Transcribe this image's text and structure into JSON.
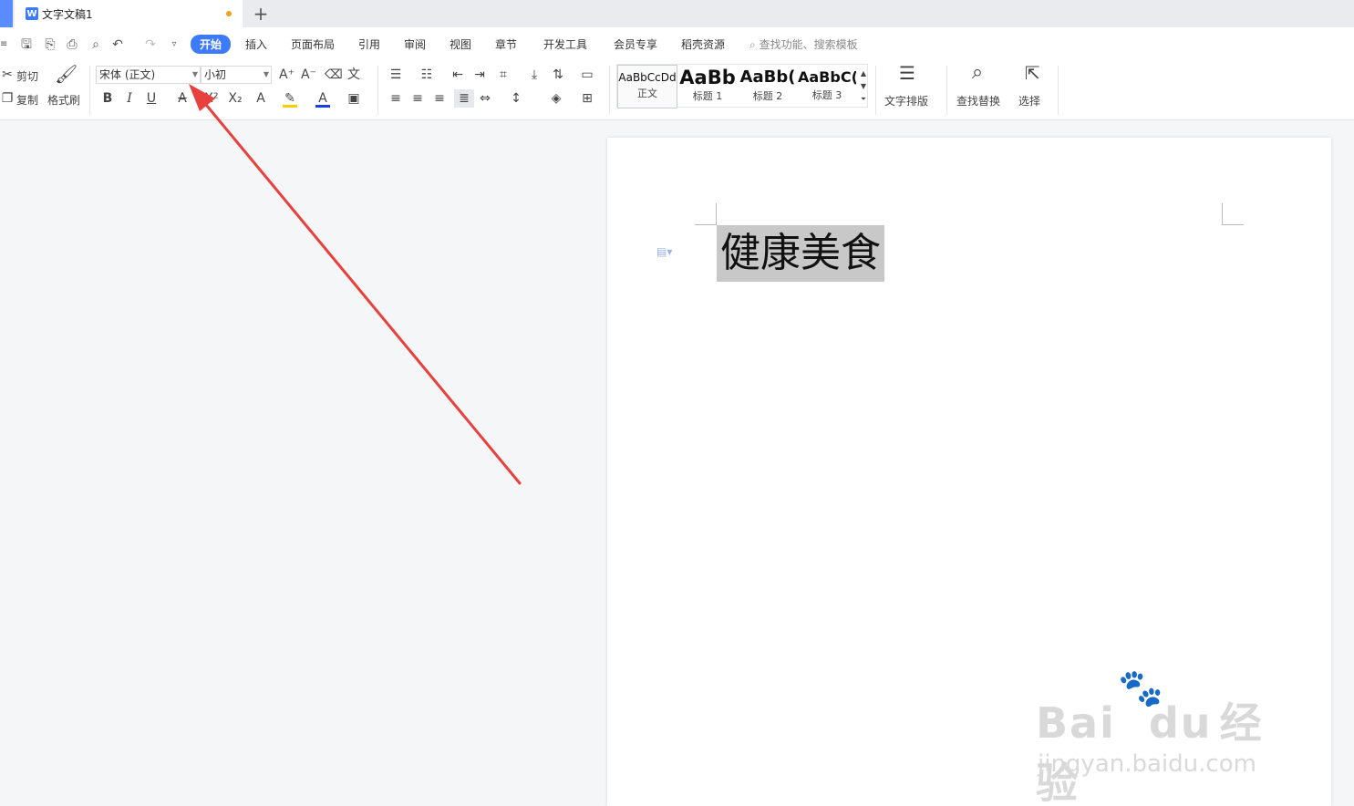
{
  "tab": {
    "title": "文字文稿1",
    "doc_icon": "W",
    "new_tab_icon": "+"
  },
  "menu": {
    "items": [
      "开始",
      "插入",
      "页面布局",
      "引用",
      "审阅",
      "视图",
      "章节",
      "开发工具",
      "会员专享",
      "稻壳资源"
    ],
    "search_placeholder": "查找功能、搜索模板"
  },
  "quick_access": [
    "save-icon",
    "export-pdf-icon",
    "print-icon",
    "print-preview-icon",
    "undo-icon",
    "redo-icon",
    "customize-icon"
  ],
  "clipboard": {
    "cut": "剪切",
    "copy": "复制",
    "format_painter": "格式刷"
  },
  "font": {
    "family": "宋体 (正文)",
    "size": "小初",
    "bold": "B",
    "italic": "I",
    "underline": "U",
    "strike": "A",
    "superscript": "X²",
    "subscript": "X₂"
  },
  "styles": [
    {
      "sample": "AaBbCcDd",
      "name": "正文"
    },
    {
      "sample": "AaBb",
      "name": "标题 1"
    },
    {
      "sample": "AaBb(",
      "name": "标题 2"
    },
    {
      "sample": "AaBbC(",
      "name": "标题 3"
    }
  ],
  "right_tools": {
    "text_layout": "文字排版",
    "find_replace": "查找替换",
    "select": "选择"
  },
  "document": {
    "heading": "健康美食"
  },
  "watermark": {
    "brand": "Bai",
    "brand2": "du",
    "cn": "经验",
    "url": "jingyan.baidu.com"
  },
  "colors": {
    "accent": "#3e7bfa",
    "arrow": "#e8403c",
    "highlight": "#c8c8c8",
    "tab_dot": "#f0a020"
  }
}
